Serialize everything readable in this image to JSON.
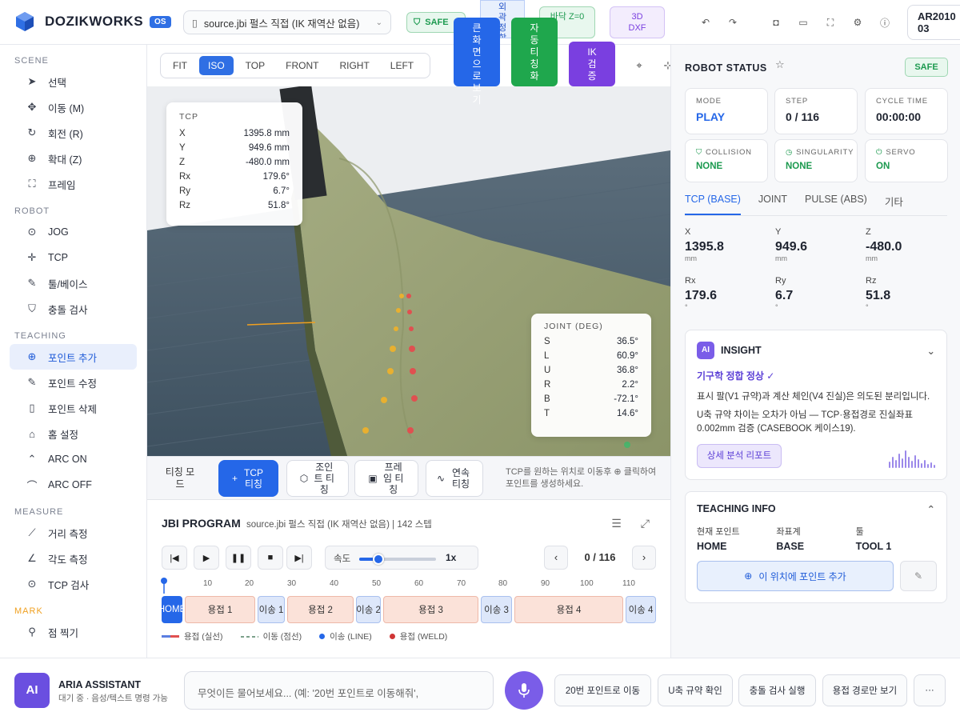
{
  "app": {
    "brand": "DOZIKWORKS",
    "badge": "OS"
  },
  "topbar": {
    "file": "source.jbi 펄스 직접 (IK 재역산 없음)",
    "safe": "SAFE",
    "col_btn": "외곽정합",
    "floor": "바닥 Z=0",
    "dxf": "3D DXF",
    "model": "AR2010 03",
    "icons": [
      "undo-icon",
      "redo-icon",
      "camera-icon",
      "video-icon",
      "fullscreen-icon",
      "settings-icon",
      "help-icon"
    ]
  },
  "sidebar": {
    "scene_title": "SCENE",
    "scene": [
      {
        "label": "선택",
        "icon": "cursor-icon"
      },
      {
        "label": "이동 (M)",
        "icon": "move-icon"
      },
      {
        "label": "회전 (R)",
        "icon": "rotate-icon"
      },
      {
        "label": "확대 (Z)",
        "icon": "zoom-icon"
      },
      {
        "label": "프레임",
        "icon": "frame-icon"
      }
    ],
    "robot_title": "ROBOT",
    "robot": [
      {
        "label": "JOG",
        "icon": "target-icon"
      },
      {
        "label": "TCP",
        "icon": "tcp-icon"
      },
      {
        "label": "툴/베이스",
        "icon": "wrench-icon"
      },
      {
        "label": "충돌 검사",
        "icon": "shield-icon"
      }
    ],
    "teaching_title": "TEACHING",
    "teaching": [
      {
        "label": "포인트 추가",
        "icon": "plus-circle-icon"
      },
      {
        "label": "포인트 수정",
        "icon": "pencil-icon"
      },
      {
        "label": "포인트 삭제",
        "icon": "trash-icon"
      },
      {
        "label": "홈 설정",
        "icon": "home-icon"
      },
      {
        "label": "ARC ON",
        "icon": "arc-on-icon"
      },
      {
        "label": "ARC OFF",
        "icon": "arc-off-icon"
      }
    ],
    "measure_title": "MEASURE",
    "measure": [
      {
        "label": "거리 측정",
        "icon": "ruler-icon"
      },
      {
        "label": "각도 측정",
        "icon": "angle-icon"
      },
      {
        "label": "TCP 검사",
        "icon": "target-check-icon"
      }
    ],
    "mark_title": "MARK",
    "mark": [
      {
        "label": "점 찍기",
        "icon": "pin-icon"
      }
    ]
  },
  "viewtabs": [
    "FIT",
    "ISO",
    "TOP",
    "FRONT",
    "RIGHT",
    "LEFT"
  ],
  "viewtab_active": "ISO",
  "vbtns": {
    "blue": "큰화면으로보기",
    "green": "자동티칭화",
    "purple": "IK 검증"
  },
  "tcp": {
    "title": "TCP",
    "rows": [
      {
        "k": "X",
        "v": "1395.8 mm"
      },
      {
        "k": "Y",
        "v": "949.6 mm"
      },
      {
        "k": "Z",
        "v": "-480.0 mm"
      },
      {
        "k": "Rx",
        "v": "179.6°"
      },
      {
        "k": "Ry",
        "v": "6.7°"
      },
      {
        "k": "Rz",
        "v": "51.8°"
      }
    ]
  },
  "joint": {
    "title": "JOINT (DEG)",
    "rows": [
      {
        "k": "S",
        "v": "36.5°"
      },
      {
        "k": "L",
        "v": "60.9°"
      },
      {
        "k": "U",
        "v": "36.8°"
      },
      {
        "k": "R",
        "v": "2.2°"
      },
      {
        "k": "B",
        "v": "-72.1°"
      },
      {
        "k": "T",
        "v": "14.6°"
      }
    ]
  },
  "teachbar": {
    "mode": "티칭 모드",
    "tcp": "TCP 티칭",
    "joint": "조인트 티칭",
    "frame": "프레임 티칭",
    "cont": "연속 티칭",
    "hint": "TCP를 원하는 위치로 이동후 ⊕ 클릭하여 포인트를 생성하세요."
  },
  "program": {
    "title": "JBI PROGRAM",
    "sub": "source.jbi 펄스 직접 (IK 재역산 없음) | 142 스텝",
    "speed_label": "속도",
    "speed": 0.25,
    "speed_value": "1x",
    "page": "0 / 116",
    "ticks": [
      "10",
      "20",
      "30",
      "40",
      "50",
      "60",
      "70",
      "80",
      "90",
      "100",
      "110"
    ],
    "segments": [
      {
        "label": "HOME",
        "kind": "h"
      },
      {
        "label": "용접 1",
        "kind": "w"
      },
      {
        "label": "이송 1",
        "kind": "m"
      },
      {
        "label": "용접 2",
        "kind": "w"
      },
      {
        "label": "이송 2",
        "kind": "m"
      },
      {
        "label": "용접 3",
        "kind": "w"
      },
      {
        "label": "이송 3",
        "kind": "m"
      },
      {
        "label": "용접 4",
        "kind": "w"
      },
      {
        "label": "이송 4",
        "kind": "m"
      }
    ],
    "legend": [
      "용접 (실선)",
      "이동 (점선)",
      "이송 (LINE)",
      "용접 (WELD)"
    ]
  },
  "status": {
    "title": "ROBOT STATUS",
    "safe": "SAFE",
    "cards": [
      {
        "l": "MODE",
        "v": "PLAY"
      },
      {
        "l": "STEP",
        "v": "0 / 116"
      },
      {
        "l": "CYCLE TIME",
        "v": "00:00:00"
      }
    ],
    "scards": [
      {
        "l": "COLLISION",
        "v": "NONE"
      },
      {
        "l": "SINGULARITY",
        "v": "NONE"
      },
      {
        "l": "SERVO",
        "v": "ON"
      }
    ],
    "tabs": [
      "TCP (BASE)",
      "JOINT",
      "PULSE (ABS)",
      "기타"
    ],
    "axes": [
      {
        "l": "X",
        "v": "1395.8",
        "u": "mm"
      },
      {
        "l": "Y",
        "v": "949.6",
        "u": "mm"
      },
      {
        "l": "Z",
        "v": "-480.0",
        "u": "mm"
      },
      {
        "l": "Rx",
        "v": "179.6",
        "u": "°"
      },
      {
        "l": "Ry",
        "v": "6.7",
        "u": "°"
      },
      {
        "l": "Rz",
        "v": "51.8",
        "u": "°"
      }
    ]
  },
  "insight": {
    "badge": "AI",
    "title": "INSIGHT",
    "ok": "기구학 정합 정상 ✓",
    "p1": "표시 팔(V1 규약)과 계산 체인(V4 진실)은 의도된 분리입니다.",
    "p2": "U축 규약 차이는 오차가 아님 — TCP·용접경로 진실좌표 0.002mm 검증 (CASEBOOK 케이스19).",
    "btn": "상세 분석 리포트"
  },
  "teaching_info": {
    "title": "TEACHING INFO",
    "cols": [
      {
        "l": "현재 포인트",
        "v": "HOME"
      },
      {
        "l": "좌표계",
        "v": "BASE"
      },
      {
        "l": "툴",
        "v": "TOOL 1"
      }
    ],
    "add": "이 위치에 포인트 추가"
  },
  "assistant": {
    "avatar": "AI",
    "name": "ARIA ASSISTANT",
    "status": "대기 중 · 음성/텍스트 명령 가능",
    "placeholder": "무엇이든 물어보세요... (예: '20번 포인트로 이동해줘',",
    "quick": [
      "20번 포인트로 이동",
      "U축 규약 확인",
      "충돌 검사 실행",
      "용접 경로만 보기",
      "···"
    ]
  }
}
